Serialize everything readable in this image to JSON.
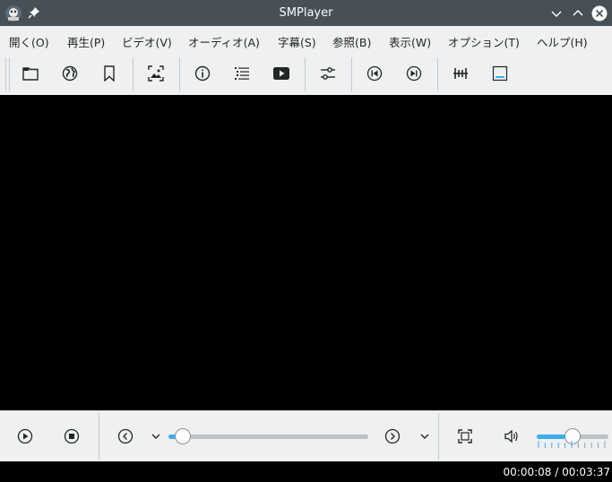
{
  "window": {
    "title": "SMPlayer"
  },
  "menu": {
    "items": [
      {
        "label": "開く(O)"
      },
      {
        "label": "再生(P)"
      },
      {
        "label": "ビデオ(V)"
      },
      {
        "label": "オーディオ(A)"
      },
      {
        "label": "字幕(S)"
      },
      {
        "label": "参照(B)"
      },
      {
        "label": "表示(W)"
      },
      {
        "label": "オプション(T)"
      },
      {
        "label": "ヘルプ(H)"
      }
    ]
  },
  "toolbar": {
    "icons": [
      "folder-icon",
      "globe-icon",
      "bookmark-icon",
      "screenshot-icon",
      "info-icon",
      "playlist-icon",
      "youtube-icon",
      "equalizer-icon",
      "previous-icon",
      "next-icon",
      "audio-equalizer-icon",
      "subtitles-icon"
    ]
  },
  "controls": {
    "seek_progress": 0.07,
    "volume_level": 0.5
  },
  "status": {
    "time": "00:00:08 / 00:03:37"
  },
  "colors": {
    "accent": "#3daee9",
    "titlebar": "#475057",
    "video": "#000000"
  }
}
